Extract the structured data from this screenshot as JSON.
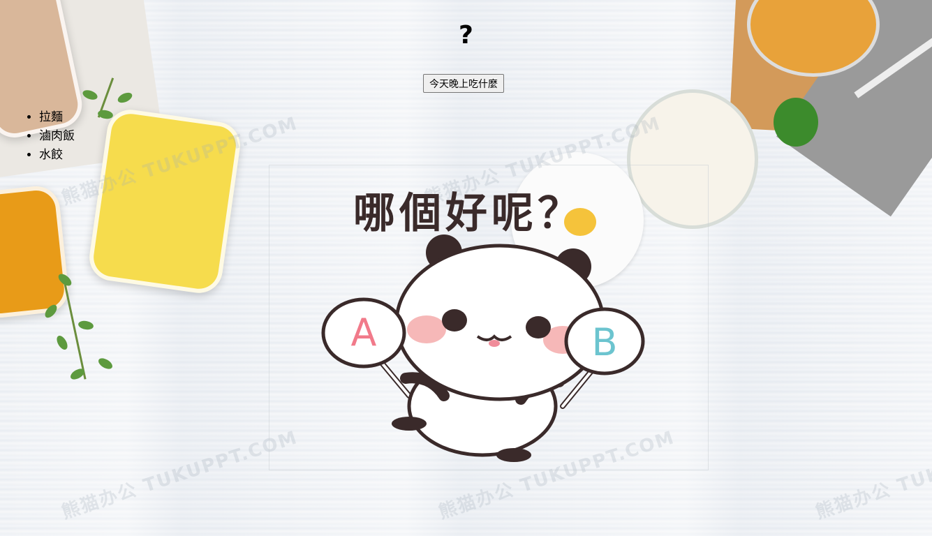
{
  "page": {
    "title": "?",
    "button_label": "今天晚上吃什麼"
  },
  "food_list": [
    "拉麵",
    "滷肉飯",
    "水餃"
  ],
  "meme": {
    "caption": "哪個好呢？",
    "sign_a": "A",
    "sign_b": "B"
  },
  "watermarks": [
    "熊猫办公 TUKUPPT.COM",
    "熊猫办公 TUKUPPT.COM",
    "熊猫办公 TUKUPPT.COM",
    "熊猫办公 TUKUPPT.COM",
    "熊猫办公 TUKUPPT.COM"
  ]
}
